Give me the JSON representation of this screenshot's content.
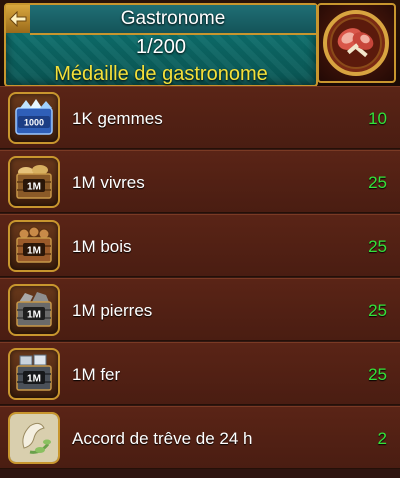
{
  "header": {
    "title": "Gastronome",
    "progress_text": "1/200",
    "medal_name": "Médaille de gastronome"
  },
  "colors": {
    "accent_gold": "#c8962e",
    "header_teal": "#0f7d7a",
    "medal_name_yellow": "#f3e03a",
    "count_green": "#33e23a",
    "row_red": "#5a2416"
  },
  "items": [
    {
      "icon": "gems-chest-icon",
      "icon_text": "1000",
      "label": "1K gemmes",
      "count": "10"
    },
    {
      "icon": "food-crate-icon",
      "icon_text": "1M",
      "label": "1M vivres",
      "count": "25"
    },
    {
      "icon": "wood-crate-icon",
      "icon_text": "1M",
      "label": "1M bois",
      "count": "25"
    },
    {
      "icon": "stone-crate-icon",
      "icon_text": "1M",
      "label": "1M pierres",
      "count": "25"
    },
    {
      "icon": "iron-crate-icon",
      "icon_text": "1M",
      "label": "1M fer",
      "count": "25"
    },
    {
      "icon": "truce-scroll-icon",
      "icon_text": "",
      "label": "Accord de trêve de 24 h",
      "count": "2"
    }
  ]
}
